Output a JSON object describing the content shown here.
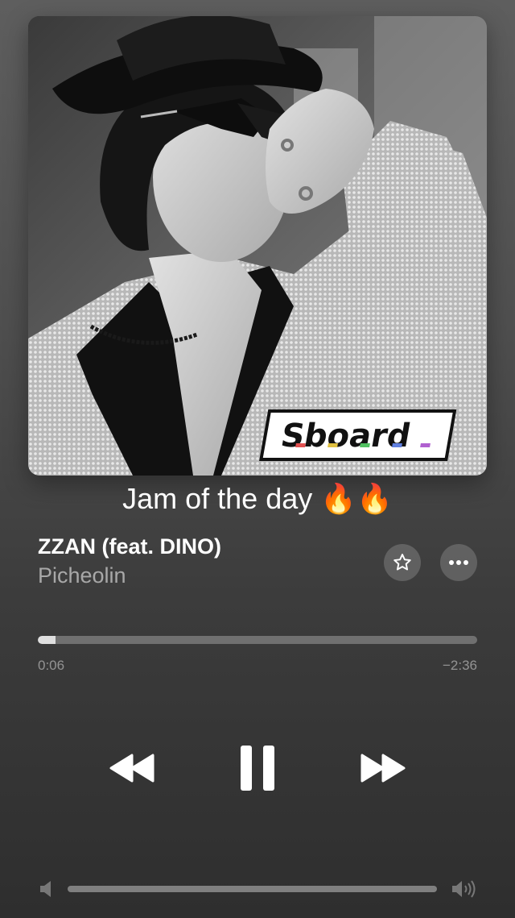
{
  "artwork": {
    "description_icon": "album-artwork",
    "sticker_text": "Sboard"
  },
  "caption": {
    "text": "Jam of the day 🔥🔥"
  },
  "track": {
    "title": "ZZAN (feat. DINO)",
    "artist": "Picheolin"
  },
  "actions": {
    "favorite_icon": "star-icon",
    "more_icon": "ellipsis-icon"
  },
  "progress": {
    "elapsed": "0:06",
    "remaining": "−2:36",
    "fraction": 0.04
  },
  "controls": {
    "previous_icon": "rewind-icon",
    "playpause_icon": "pause-icon",
    "next_icon": "fast-forward-icon"
  },
  "volume": {
    "level": 1.0,
    "low_icon": "speaker-low-icon",
    "high_icon": "speaker-high-icon"
  },
  "colors": {
    "background_top": "#5e5e5e",
    "background_bottom": "#2e2e2e",
    "text_primary": "#ffffff",
    "text_secondary": "#9a9a9a"
  }
}
